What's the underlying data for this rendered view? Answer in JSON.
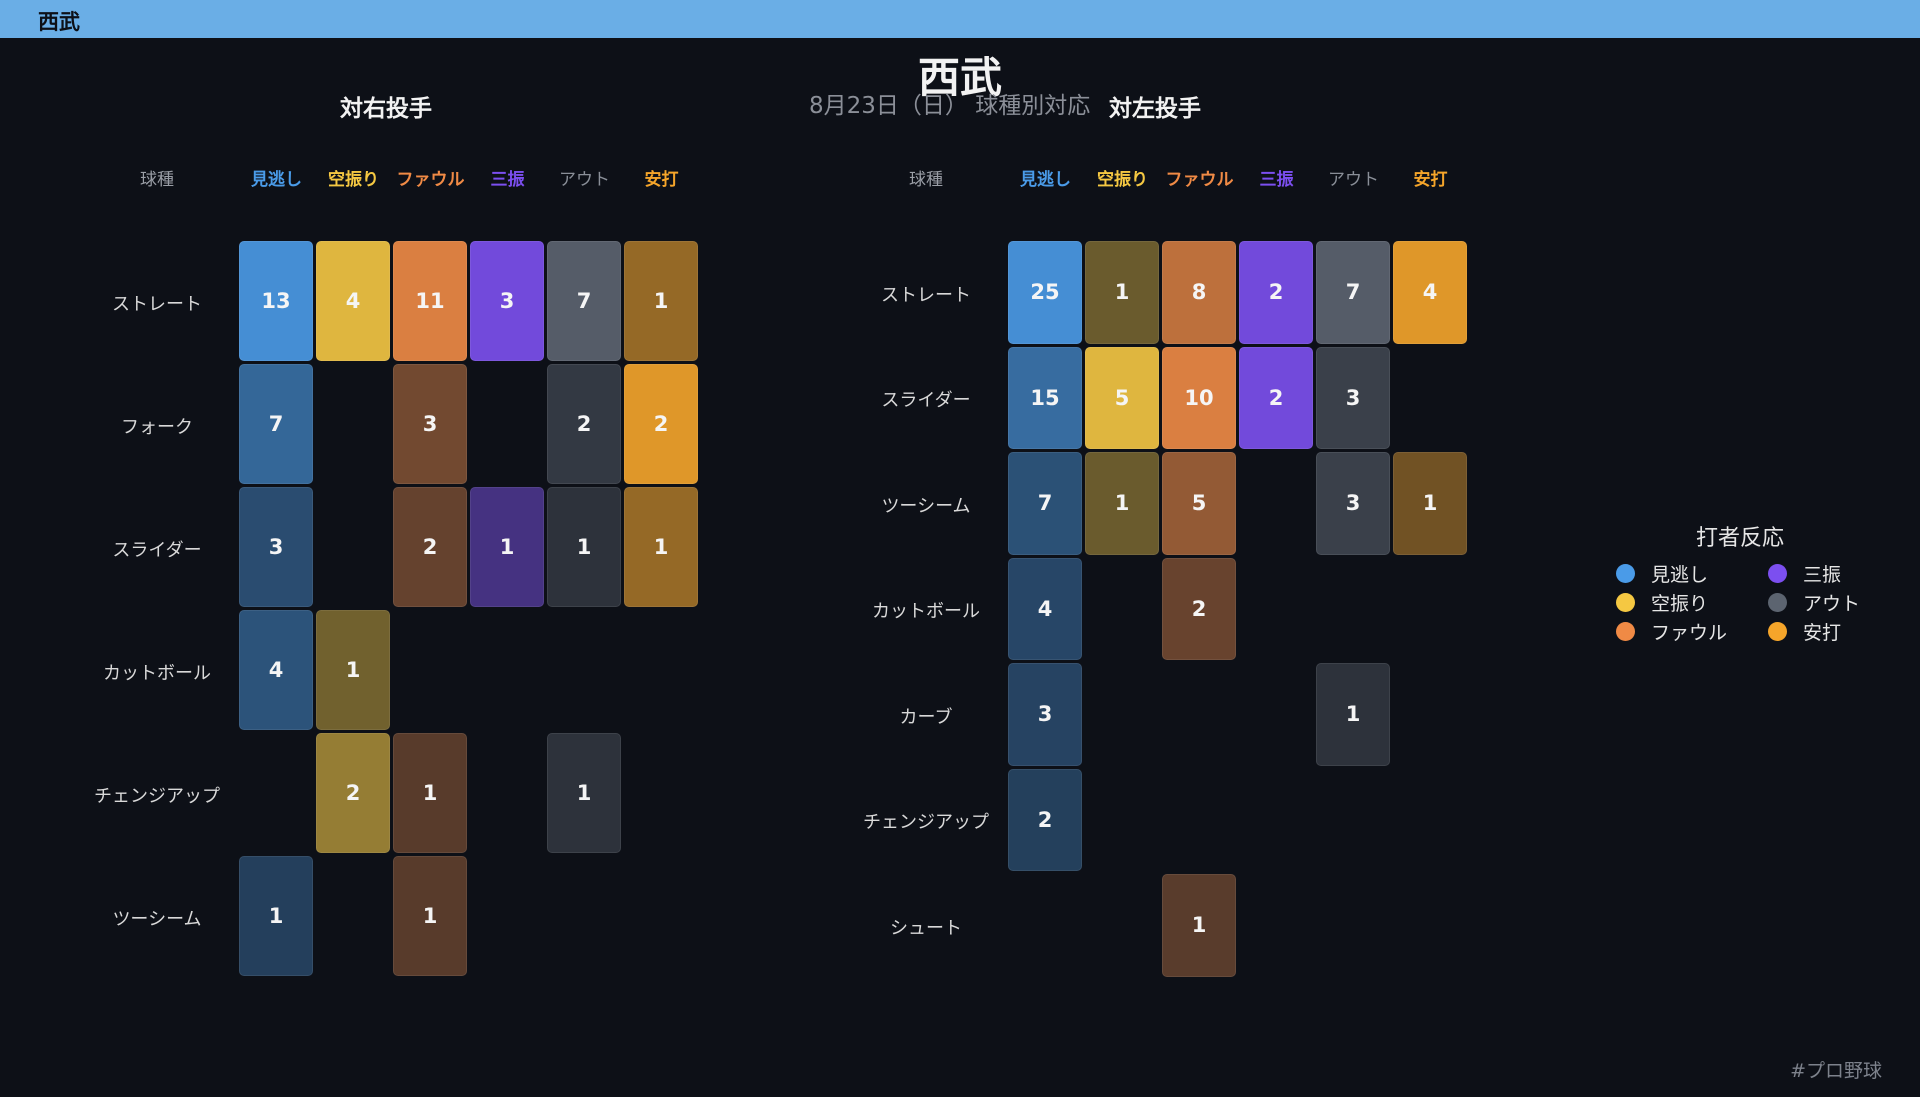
{
  "header": {
    "team": "西武"
  },
  "title": "西武",
  "subtitle": "8月23日（日） 球種別対応",
  "footer": "#プロ野球",
  "legend": {
    "title": "打者反応",
    "items": [
      {
        "label": "見逃し",
        "color": "#4a9be8"
      },
      {
        "label": "三振",
        "color": "#7c4ff0"
      },
      {
        "label": "空振り",
        "color": "#f5c842"
      },
      {
        "label": "アウト",
        "color": "#5c6470"
      },
      {
        "label": "ファウル",
        "color": "#f08a45"
      },
      {
        "label": "安打",
        "color": "#f5a52a"
      }
    ]
  },
  "chart_data": [
    {
      "type": "heatmap",
      "title": "対右投手",
      "row_header": "球種",
      "columns": [
        "見逃し",
        "空振り",
        "ファウル",
        "三振",
        "アウト",
        "安打"
      ],
      "column_colors": [
        "#4a9be8",
        "#f5c842",
        "#f08a45",
        "#7c4ff0",
        "#5c6470",
        "#f5a52a"
      ],
      "rows": [
        "ストレート",
        "フォーク",
        "スライダー",
        "カットボール",
        "チェンジアップ",
        "ツーシーム"
      ],
      "values": [
        [
          13,
          4,
          11,
          3,
          7,
          1
        ],
        [
          7,
          null,
          3,
          null,
          2,
          2
        ],
        [
          3,
          null,
          2,
          1,
          1,
          1
        ],
        [
          4,
          1,
          null,
          null,
          null,
          null
        ],
        [
          null,
          2,
          1,
          null,
          1,
          null
        ],
        [
          1,
          null,
          1,
          null,
          null,
          null
        ]
      ]
    },
    {
      "type": "heatmap",
      "title": "対左投手",
      "row_header": "球種",
      "columns": [
        "見逃し",
        "空振り",
        "ファウル",
        "三振",
        "アウト",
        "安打"
      ],
      "column_colors": [
        "#4a9be8",
        "#f5c842",
        "#f08a45",
        "#7c4ff0",
        "#5c6470",
        "#f5a52a"
      ],
      "rows": [
        "ストレート",
        "スライダー",
        "ツーシーム",
        "カットボール",
        "カーブ",
        "チェンジアップ",
        "シュート"
      ],
      "values": [
        [
          25,
          1,
          8,
          2,
          7,
          4
        ],
        [
          15,
          5,
          10,
          2,
          3,
          null
        ],
        [
          7,
          1,
          5,
          null,
          3,
          1
        ],
        [
          4,
          null,
          2,
          null,
          null,
          null
        ],
        [
          3,
          null,
          null,
          null,
          1,
          null
        ],
        [
          2,
          null,
          null,
          null,
          null,
          null
        ],
        [
          null,
          null,
          1,
          null,
          null,
          null
        ]
      ]
    }
  ]
}
